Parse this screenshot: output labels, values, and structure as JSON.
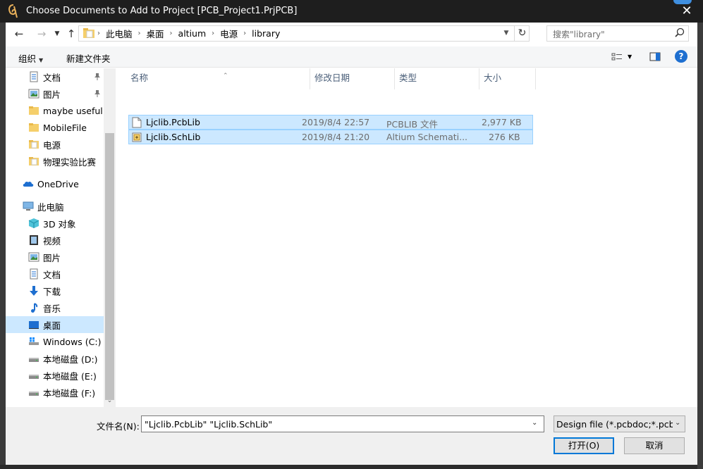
{
  "window": {
    "title": "Choose Documents to Add to Project [PCB_Project1.PrjPCB]",
    "close_glyph": "✕"
  },
  "address": {
    "crumbs": [
      "此电脑",
      "桌面",
      "altium",
      "电源",
      "library"
    ],
    "search_placeholder": "搜索\"library\""
  },
  "toolbar": {
    "organize": "组织",
    "new_folder": "新建文件夹",
    "help": "?"
  },
  "sidebar": {
    "items": [
      {
        "label": "文档",
        "icon": "document-icon",
        "pinned": true
      },
      {
        "label": "图片",
        "icon": "pictures-icon",
        "pinned": true
      },
      {
        "label": "maybe useful",
        "icon": "folder-icon"
      },
      {
        "label": "MobileFile",
        "icon": "folder-icon"
      },
      {
        "label": "电源",
        "icon": "folder-icon"
      },
      {
        "label": "物理实验比赛",
        "icon": "folder-icon"
      },
      {
        "label": "OneDrive",
        "icon": "cloud-icon"
      },
      {
        "label": "此电脑",
        "icon": "computer-icon"
      },
      {
        "label": "3D 对象",
        "icon": "3d-objects-icon"
      },
      {
        "label": "视频",
        "icon": "video-icon"
      },
      {
        "label": "图片",
        "icon": "pictures-icon"
      },
      {
        "label": "文档",
        "icon": "document-icon"
      },
      {
        "label": "下载",
        "icon": "download-icon"
      },
      {
        "label": "音乐",
        "icon": "music-icon"
      },
      {
        "label": "桌面",
        "icon": "desktop-icon",
        "selected": true
      },
      {
        "label": "Windows (C:)",
        "icon": "windows-drive-icon"
      },
      {
        "label": "本地磁盘 (D:)",
        "icon": "drive-icon"
      },
      {
        "label": "本地磁盘 (E:)",
        "icon": "drive-icon"
      },
      {
        "label": "本地磁盘 (F:)",
        "icon": "drive-icon"
      }
    ]
  },
  "filelist": {
    "columns": [
      "名称",
      "修改日期",
      "类型",
      "大小"
    ],
    "rows": [
      {
        "name": "Ljclib.PcbLib",
        "date": "2019/8/4 22:57",
        "type": "PCBLIB 文件",
        "size": "2,977 KB",
        "icon": "pcblib-file-icon"
      },
      {
        "name": "Ljclib.SchLib",
        "date": "2019/8/4 21:20",
        "type": "Altium Schemati...",
        "size": "276 KB",
        "icon": "schlib-file-icon"
      }
    ]
  },
  "bottom": {
    "filename_label": "文件名(N):",
    "filename_value": "\"Ljclib.PcbLib\" \"Ljclib.SchLib\"",
    "filter_value": "Design file (*.pcbdoc;*.pcb;*.",
    "open_button": "打开(O)",
    "cancel_button": "取消"
  },
  "colors": {
    "selection": "#cce8ff",
    "selection_border": "#99d1ff",
    "accent": "#0078d7",
    "titlebar": "#1e1e1e"
  }
}
